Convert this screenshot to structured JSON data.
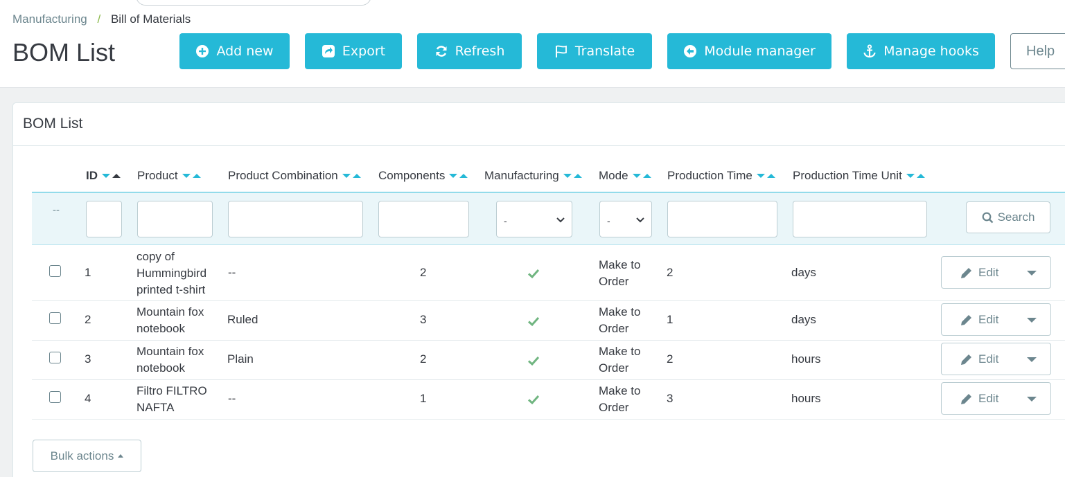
{
  "breadcrumb": {
    "parent": "Manufacturing",
    "separator": "/",
    "current": "Bill of Materials"
  },
  "page_title": "BOM List",
  "toolbar": {
    "add_new": "Add new",
    "export": "Export",
    "refresh": "Refresh",
    "translate": "Translate",
    "module_manager": "Module manager",
    "manage_hooks": "Manage hooks",
    "help": "Help"
  },
  "panel": {
    "title": "BOM List"
  },
  "table": {
    "columns": [
      "ID",
      "Product",
      "Product Combination",
      "Components",
      "Manufacturing",
      "Mode",
      "Production Time",
      "Production Time Unit"
    ],
    "filter": {
      "row_dash": "--",
      "manufacturing_select": "-",
      "mode_select": "-",
      "search_label": "Search"
    },
    "rows": [
      {
        "id": "1",
        "product": "copy of Hummingbird printed t-shirt",
        "combination": "--",
        "components": "2",
        "manufacturing": true,
        "mode": "Make to Order",
        "production_time": "2",
        "unit": "days"
      },
      {
        "id": "2",
        "product": "Mountain fox notebook",
        "combination": "Ruled",
        "components": "3",
        "manufacturing": true,
        "mode": "Make to Order",
        "production_time": "1",
        "unit": "days"
      },
      {
        "id": "3",
        "product": "Mountain fox notebook",
        "combination": "Plain",
        "components": "2",
        "manufacturing": true,
        "mode": "Make to Order",
        "production_time": "2",
        "unit": "hours"
      },
      {
        "id": "4",
        "product": "Filtro FILTRO NAFTA",
        "combination": "--",
        "components": "1",
        "manufacturing": true,
        "mode": "Make to Order",
        "production_time": "3",
        "unit": "hours"
      }
    ],
    "edit_label": "Edit",
    "bulk_actions": "Bulk actions"
  },
  "colors": {
    "accent": "#25b9d7",
    "text": "#363a41",
    "muted": "#6c868e",
    "success": "#70b580"
  }
}
